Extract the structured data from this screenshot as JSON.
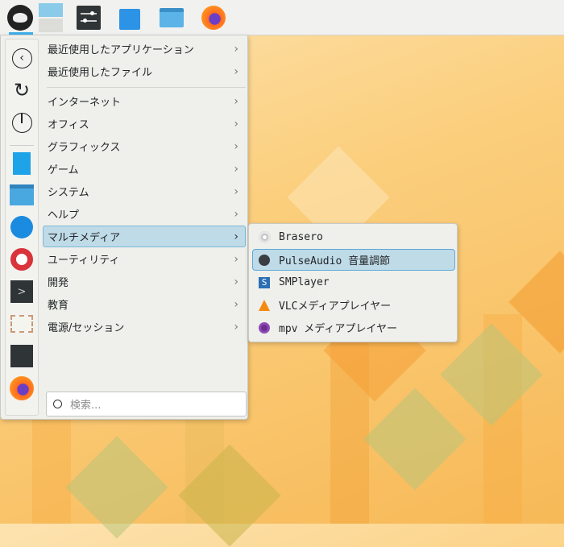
{
  "panel": {
    "launcher_icon": "opensuse-icon",
    "tasks": [
      "desktop-pager-icon",
      "settings-icon",
      "discover-icon",
      "file-manager-icon",
      "firefox-icon"
    ]
  },
  "sidebar": {
    "icons": [
      "back-icon",
      "refresh-icon",
      "power-icon",
      "writer-icon",
      "file-manager-icon",
      "kmail-icon",
      "help-icon",
      "terminal-icon",
      "mail-icon",
      "settings-icon",
      "firefox-icon"
    ]
  },
  "menu": {
    "items": [
      {
        "label": "最近使用したアプリケーション"
      },
      {
        "label": "最近使用したファイル"
      },
      {
        "label": "インターネット"
      },
      {
        "label": "オフィス"
      },
      {
        "label": "グラフィックス"
      },
      {
        "label": "ゲーム"
      },
      {
        "label": "システム"
      },
      {
        "label": "ヘルプ"
      },
      {
        "label": "マルチメディア"
      },
      {
        "label": "ユーティリティ"
      },
      {
        "label": "開発"
      },
      {
        "label": "教育"
      },
      {
        "label": "電源/セッション"
      }
    ],
    "search_placeholder": "検索..."
  },
  "submenu": {
    "items": [
      {
        "label": "Brasero",
        "icon": "disc-icon"
      },
      {
        "label": "PulseAudio 音量調節",
        "icon": "audio-icon"
      },
      {
        "label": "SMPlayer",
        "icon": "smplayer-icon"
      },
      {
        "label": "VLCメディアプレイヤー",
        "icon": "vlc-icon"
      },
      {
        "label": "mpv メディアプレイヤー",
        "icon": "mpv-icon"
      }
    ]
  },
  "colors": {
    "highlight": "#bfdbe8",
    "accent": "#3daee9"
  }
}
